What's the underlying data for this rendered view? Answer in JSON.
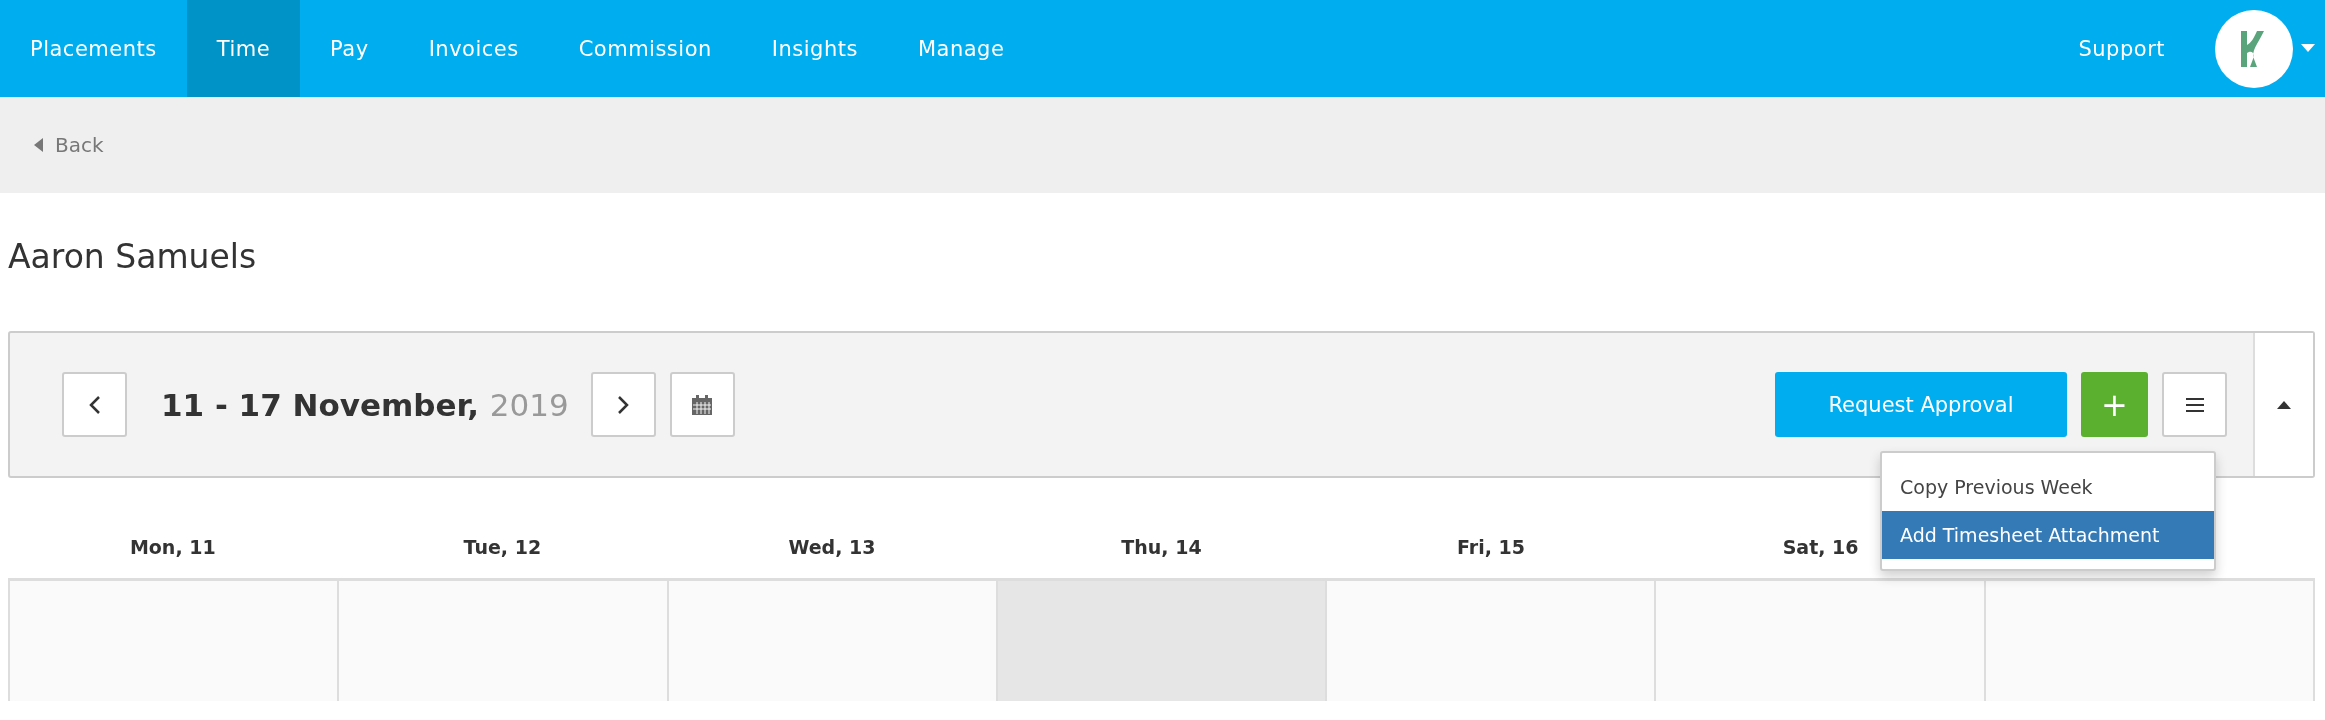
{
  "nav": {
    "items": [
      {
        "label": "Placements",
        "selected": false
      },
      {
        "label": "Time",
        "selected": true
      },
      {
        "label": "Pay",
        "selected": false
      },
      {
        "label": "Invoices",
        "selected": false
      },
      {
        "label": "Commission",
        "selected": false
      },
      {
        "label": "Insights",
        "selected": false
      },
      {
        "label": "Manage",
        "selected": false
      }
    ],
    "support": "Support"
  },
  "back": "Back",
  "title": "Aaron Samuels",
  "week": {
    "range": "11 - 17 November,",
    "year": "2019"
  },
  "actions": {
    "request": "Request Approval",
    "add": "+"
  },
  "menu": {
    "items": [
      {
        "label": "Copy Previous Week",
        "selected": false
      },
      {
        "label": "Add Timesheet Attachment",
        "selected": true
      }
    ]
  },
  "days": [
    {
      "label": "Mon, 11",
      "today": false
    },
    {
      "label": "Tue, 12",
      "today": false
    },
    {
      "label": "Wed, 13",
      "today": false
    },
    {
      "label": "Thu, 14",
      "today": true
    },
    {
      "label": "Fri, 15",
      "today": false
    },
    {
      "label": "Sat, 16",
      "today": false
    },
    {
      "today": false
    }
  ]
}
